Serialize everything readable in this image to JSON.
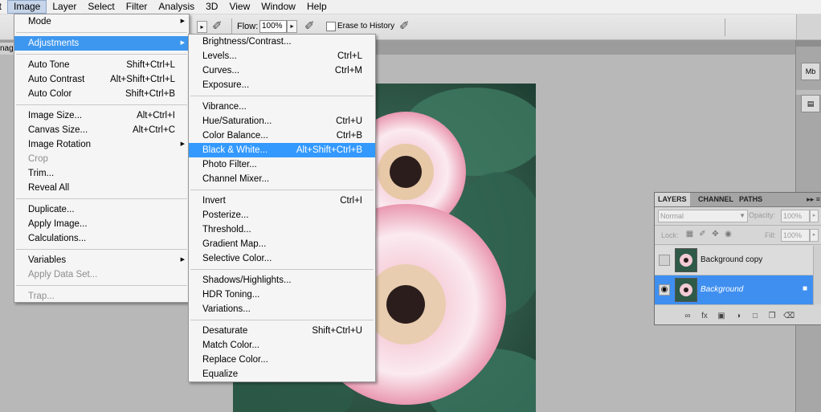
{
  "menubar": {
    "items": [
      "it",
      "Image",
      "Layer",
      "Select",
      "Filter",
      "Analysis",
      "3D",
      "View",
      "Window",
      "Help"
    ],
    "active": "Image"
  },
  "options_bar": {
    "flow_label": "Flow:",
    "flow_value": "100%",
    "erase_to_history": "Erase to History"
  },
  "doc_tab": {
    "label": "nag"
  },
  "image_menu": {
    "items": [
      {
        "label": "Mode",
        "shortcut": "",
        "submenu": true
      },
      {
        "sep": true
      },
      {
        "label": "Adjustments",
        "shortcut": "",
        "submenu": true,
        "highlight": true
      },
      {
        "sep": true
      },
      {
        "label": "Auto Tone",
        "shortcut": "Shift+Ctrl+L"
      },
      {
        "label": "Auto Contrast",
        "shortcut": "Alt+Shift+Ctrl+L"
      },
      {
        "label": "Auto Color",
        "shortcut": "Shift+Ctrl+B"
      },
      {
        "sep": true
      },
      {
        "label": "Image Size...",
        "shortcut": "Alt+Ctrl+I"
      },
      {
        "label": "Canvas Size...",
        "shortcut": "Alt+Ctrl+C"
      },
      {
        "label": "Image Rotation",
        "shortcut": "",
        "submenu": true
      },
      {
        "label": "Crop",
        "shortcut": "",
        "disabled": true
      },
      {
        "label": "Trim...",
        "shortcut": ""
      },
      {
        "label": "Reveal All",
        "shortcut": ""
      },
      {
        "sep": true
      },
      {
        "label": "Duplicate...",
        "shortcut": ""
      },
      {
        "label": "Apply Image...",
        "shortcut": ""
      },
      {
        "label": "Calculations...",
        "shortcut": ""
      },
      {
        "sep": true
      },
      {
        "label": "Variables",
        "shortcut": "",
        "submenu": true
      },
      {
        "label": "Apply Data Set...",
        "shortcut": "",
        "disabled": true
      },
      {
        "sep": true
      },
      {
        "label": "Trap...",
        "shortcut": "",
        "disabled": true
      }
    ]
  },
  "adjustments_menu": {
    "items": [
      {
        "label": "Brightness/Contrast...",
        "shortcut": ""
      },
      {
        "label": "Levels...",
        "shortcut": "Ctrl+L"
      },
      {
        "label": "Curves...",
        "shortcut": "Ctrl+M"
      },
      {
        "label": "Exposure...",
        "shortcut": ""
      },
      {
        "sep": true
      },
      {
        "label": "Vibrance...",
        "shortcut": ""
      },
      {
        "label": "Hue/Saturation...",
        "shortcut": "Ctrl+U"
      },
      {
        "label": "Color Balance...",
        "shortcut": "Ctrl+B"
      },
      {
        "label": "Black & White...",
        "shortcut": "Alt+Shift+Ctrl+B",
        "highlight": true
      },
      {
        "label": "Photo Filter...",
        "shortcut": ""
      },
      {
        "label": "Channel Mixer...",
        "shortcut": ""
      },
      {
        "sep": true
      },
      {
        "label": "Invert",
        "shortcut": "Ctrl+I"
      },
      {
        "label": "Posterize...",
        "shortcut": ""
      },
      {
        "label": "Threshold...",
        "shortcut": ""
      },
      {
        "label": "Gradient Map...",
        "shortcut": ""
      },
      {
        "label": "Selective Color...",
        "shortcut": ""
      },
      {
        "sep": true
      },
      {
        "label": "Shadows/Highlights...",
        "shortcut": ""
      },
      {
        "label": "HDR Toning...",
        "shortcut": ""
      },
      {
        "label": "Variations...",
        "shortcut": ""
      },
      {
        "sep": true
      },
      {
        "label": "Desaturate",
        "shortcut": "Shift+Ctrl+U"
      },
      {
        "label": "Match Color...",
        "shortcut": ""
      },
      {
        "label": "Replace Color...",
        "shortcut": ""
      },
      {
        "label": "Equalize",
        "shortcut": ""
      }
    ]
  },
  "layers_panel": {
    "tabs": [
      "LAYERS",
      "CHANNEL",
      "PATHS"
    ],
    "blend_mode": "Normal",
    "opacity_label": "Opacity:",
    "opacity_value": "100%",
    "lock_label": "Lock:",
    "fill_label": "Fill:",
    "fill_value": "100%",
    "layers": [
      {
        "name": "Background copy",
        "visible": false,
        "selected": false
      },
      {
        "name": "Background",
        "visible": true,
        "selected": true,
        "locked": true
      }
    ]
  },
  "colors": {
    "menu_highlight": "#3399ff",
    "layer_selected": "#3f8ff0"
  }
}
